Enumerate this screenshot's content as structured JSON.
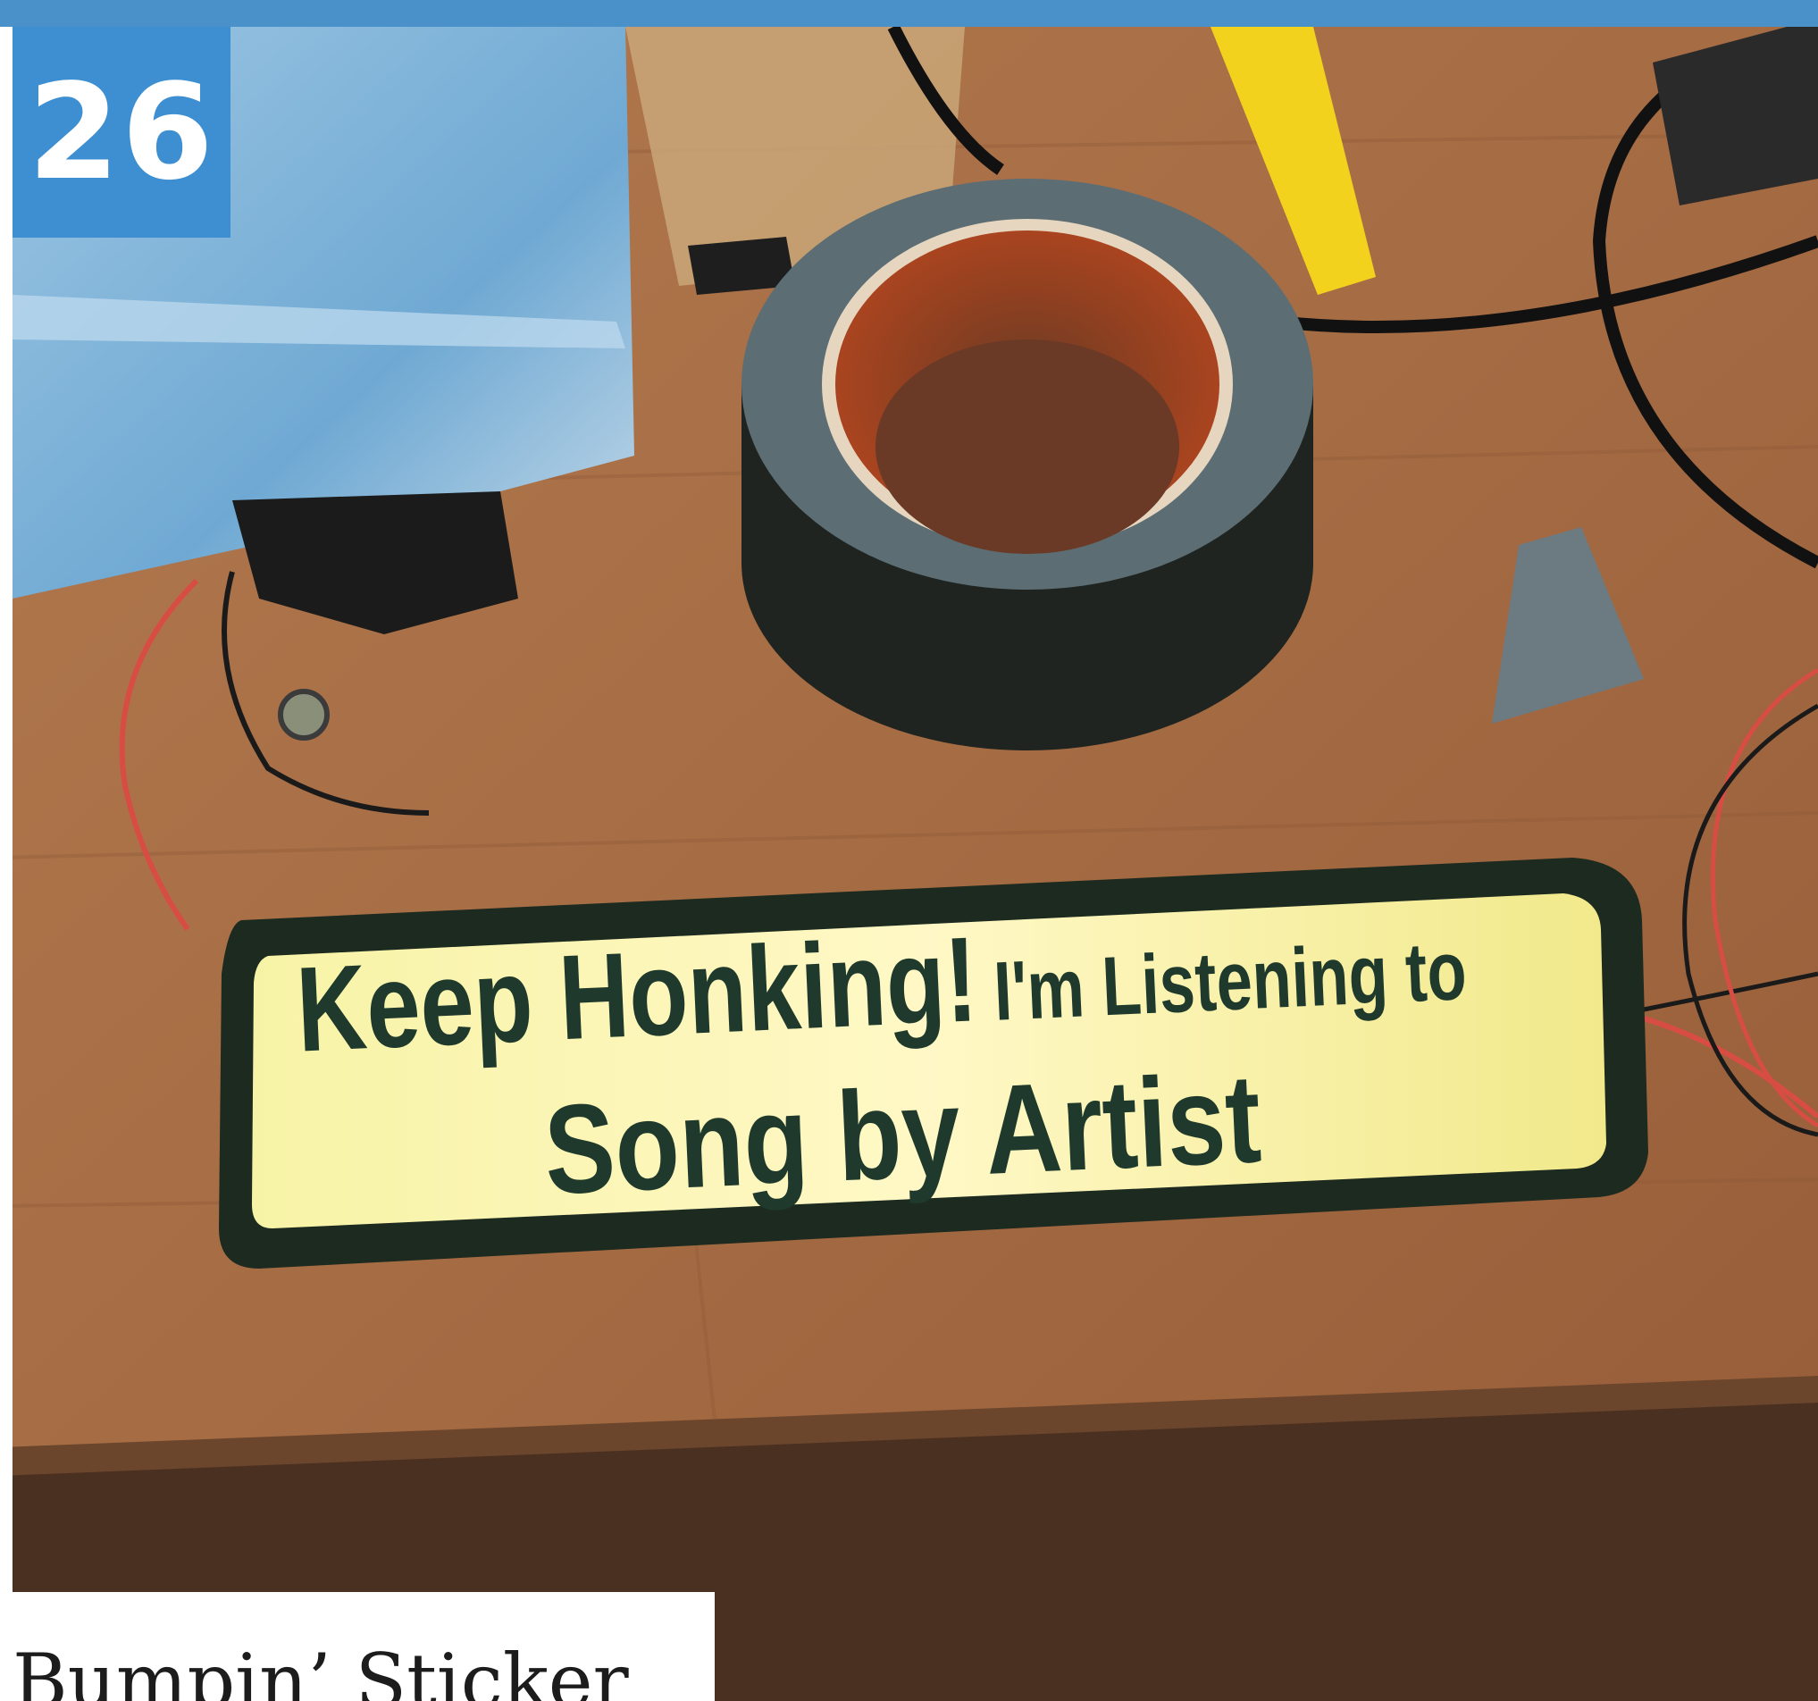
{
  "badge": {
    "number": "26"
  },
  "sticker": {
    "line1_main": "Keep Honking!",
    "line1_small": "I'm Listening to",
    "line2": "Song by Artist"
  },
  "caption": {
    "title": "Bumpin’ Sticker"
  },
  "colors": {
    "accent_blue": "#3d8fd1",
    "table_wood": "#a86e45",
    "sticker_yellow": "#f3f08a",
    "sticker_text": "#1f3a2c"
  }
}
